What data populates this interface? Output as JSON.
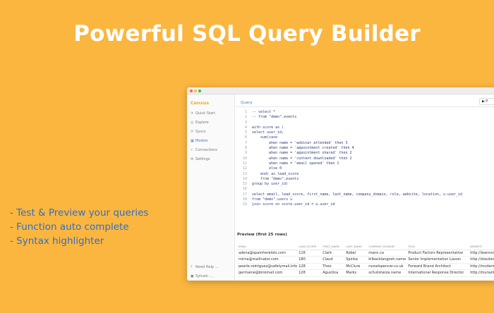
{
  "headline": "Powerful SQL Query Builder",
  "features": [
    "- Test & Preview your queries",
    "- Function auto complete",
    "- Syntax highlighter"
  ],
  "app": {
    "brand": "Census",
    "nav": [
      {
        "label": "Quick Start",
        "icon": "rocket-icon"
      },
      {
        "label": "Explore",
        "icon": "compass-icon"
      },
      {
        "label": "Syncs",
        "icon": "sync-icon"
      },
      {
        "label": "Models",
        "icon": "grid-icon"
      },
      {
        "label": "Connections",
        "icon": "plug-icon"
      },
      {
        "label": "Settings",
        "icon": "gear-icon"
      }
    ],
    "nav_bottom": [
      {
        "label": "Need Help ...",
        "icon": "help-icon"
      },
      {
        "label": "Sylvain ...",
        "icon": "user-icon"
      }
    ],
    "tab_label": "Query",
    "topbar_button": "P",
    "preview_label": "Preview (first 25 rows)"
  },
  "code_lines": [
    {
      "n": "1",
      "t": "-- select *"
    },
    {
      "n": "2",
      "t": "-- from \"demo\".events"
    },
    {
      "n": "3",
      "t": ""
    },
    {
      "n": "4",
      "t": "with score as ("
    },
    {
      "n": "5",
      "t": "select user_id,"
    },
    {
      "n": "6",
      "t": "    sum(case"
    },
    {
      "n": "7",
      "t": "        when name = 'webinar attended' then 3"
    },
    {
      "n": "8",
      "t": "        when name = 'appointment created' then 4"
    },
    {
      "n": "9",
      "t": "        when name = 'appointment shared' then 2"
    },
    {
      "n": "10",
      "t": "        when name = 'content downloaded' then 2"
    },
    {
      "n": "11",
      "t": "        when name = 'email opened' then 1"
    },
    {
      "n": "12",
      "t": "        else 0"
    },
    {
      "n": "13",
      "t": "    end) as lead_score"
    },
    {
      "n": "14",
      "t": "    from \"demo\".events"
    },
    {
      "n": "15",
      "t": "group by user_id)"
    },
    {
      "n": "16",
      "t": ""
    },
    {
      "n": "17",
      "t": "select email, lead_score, first_name, last_name, company_domain, role, website, location, u.user_id"
    },
    {
      "n": "18",
      "t": "from \"demo\".users u"
    },
    {
      "n": "19",
      "t": "join score on score.user_id = u.user_id"
    }
  ],
  "table": {
    "columns": [
      "EMAIL",
      "LEAD_SCORE",
      "FIRST_NAME",
      "LAST_NAME",
      "COMPANY_DOMAIN",
      "ROLE",
      "WEBSITE"
    ],
    "rows": [
      [
        "adena@spamherelots.com",
        "116",
        "Clark",
        "Robel",
        "mann.ca",
        "Product Factors Representative",
        "http://leannon"
      ],
      [
        "mirna@mailinator.com",
        "180",
        "Claud",
        "Spinka",
        "kilbacklangosh.name",
        "Senior Implementation Liason",
        "http://steuber"
      ],
      [
        "pearle.rodriguez@safetymail.info",
        "128",
        "Theo",
        "McClure",
        "russelspencer.co.uk",
        "Forward Brand Architect",
        "http://mcdermo"
      ],
      [
        "germaine@binkmail.com",
        "128",
        "Agustina",
        "Marks",
        "schulistwiza.name",
        "International Response Director",
        "http://murazik"
      ]
    ]
  },
  "colors": {
    "background": "#fbb640",
    "headline": "#ffffff",
    "features": "#2f6fc4",
    "brand": "#f5a623",
    "accent": "#4a78c8"
  }
}
